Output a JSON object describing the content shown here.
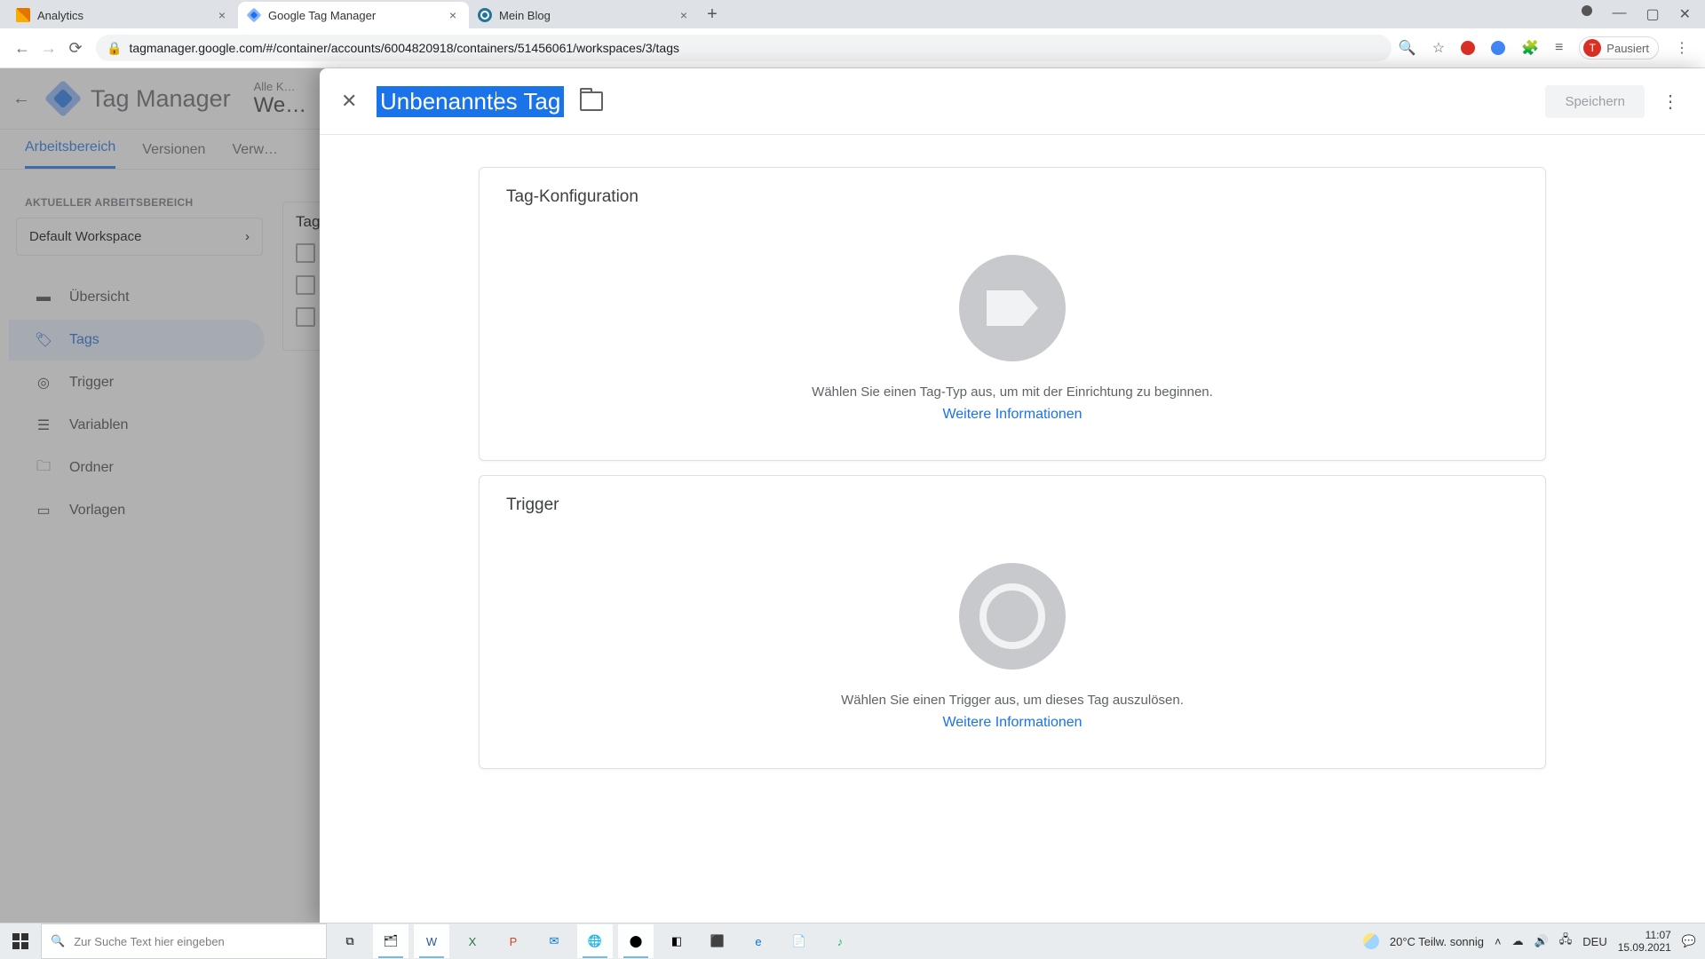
{
  "browser": {
    "tabs": [
      {
        "title": "Analytics"
      },
      {
        "title": "Google Tag Manager"
      },
      {
        "title": "Mein Blog"
      }
    ],
    "url": "tagmanager.google.com/#/container/accounts/6004820918/containers/51456061/workspaces/3/tags",
    "profile_label": "Pausiert",
    "profile_initial": "T"
  },
  "gtm": {
    "app_title": "Tag Manager",
    "crumb_top": "Alle K…",
    "crumb_container": "We…",
    "tabs": {
      "workspace": "Arbeitsbereich",
      "versions": "Versionen",
      "admin": "Verw…"
    },
    "workspace_label": "AKTUELLER ARBEITSBEREICH",
    "workspace_name": "Default Workspace",
    "nav": {
      "overview": "Übersicht",
      "tags": "Tags",
      "triggers": "Trigger",
      "variables": "Variablen",
      "folders": "Ordner",
      "templates": "Vorlagen"
    },
    "tags_panel_title": "Tag…"
  },
  "sheet": {
    "tag_name": "Unbenanntes Tag",
    "save": "Speichern",
    "config": {
      "title": "Tag-Konfiguration",
      "hint": "Wählen Sie einen Tag-Typ aus, um mit der Einrichtung zu beginnen.",
      "link": "Weitere Informationen"
    },
    "trigger": {
      "title": "Trigger",
      "hint": "Wählen Sie einen Trigger aus, um dieses Tag auszulösen.",
      "link": "Weitere Informationen"
    }
  },
  "taskbar": {
    "search_placeholder": "Zur Suche Text hier eingeben",
    "weather": "20°C  Teilw. sonnig",
    "lang": "DEU",
    "time": "11:07",
    "date": "15.09.2021"
  }
}
